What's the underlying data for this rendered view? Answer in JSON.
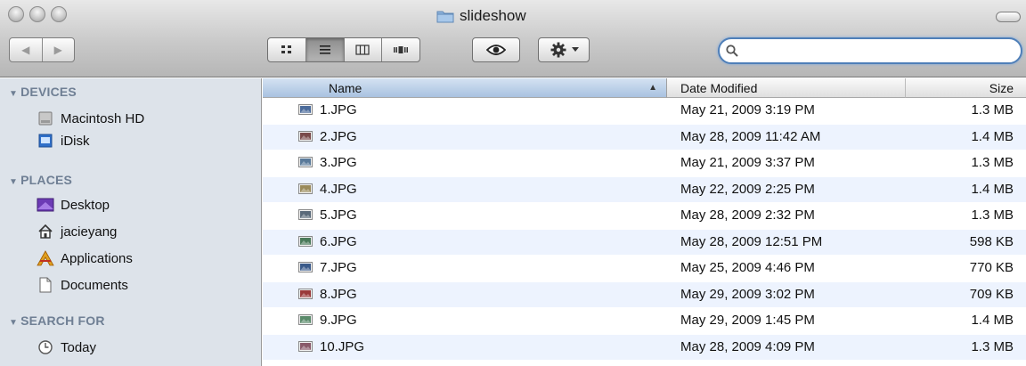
{
  "window": {
    "title": "slideshow"
  },
  "toolbar": {
    "back_glyph": "◀",
    "forward_glyph": "▶",
    "search": {
      "value": "",
      "placeholder": ""
    }
  },
  "sidebar": {
    "devices": {
      "label": "DEVICES",
      "items": [
        {
          "label": "Macintosh HD",
          "icon": "hard-drive-icon"
        },
        {
          "label": "iDisk",
          "icon": "idisk-icon"
        }
      ]
    },
    "places": {
      "label": "PLACES",
      "items": [
        {
          "label": "Desktop",
          "icon": "desktop-icon"
        },
        {
          "label": "jacieyang",
          "icon": "home-icon"
        },
        {
          "label": "Applications",
          "icon": "applications-icon"
        },
        {
          "label": "Documents",
          "icon": "documents-icon"
        }
      ]
    },
    "search_for": {
      "label": "SEARCH FOR",
      "items": [
        {
          "label": "Today",
          "icon": "clock-icon"
        }
      ]
    }
  },
  "columns": {
    "name": "Name",
    "date": "Date Modified",
    "size": "Size"
  },
  "files": [
    {
      "name": "1.JPG",
      "date": "May 21, 2009 3:19 PM",
      "size": "1.3 MB",
      "thumb": "#4a6a9a"
    },
    {
      "name": "2.JPG",
      "date": "May 28, 2009 11:42 AM",
      "size": "1.4 MB",
      "thumb": "#7a4a4a"
    },
    {
      "name": "3.JPG",
      "date": "May 21, 2009 3:37 PM",
      "size": "1.3 MB",
      "thumb": "#5a7a9a"
    },
    {
      "name": "4.JPG",
      "date": "May 22, 2009 2:25 PM",
      "size": "1.4 MB",
      "thumb": "#9a8a5a"
    },
    {
      "name": "5.JPG",
      "date": "May 28, 2009 2:32 PM",
      "size": "1.3 MB",
      "thumb": "#5a6a7a"
    },
    {
      "name": "6.JPG",
      "date": "May 28, 2009 12:51 PM",
      "size": "598 KB",
      "thumb": "#4a7a5a"
    },
    {
      "name": "7.JPG",
      "date": "May 25, 2009 4:46 PM",
      "size": "770 KB",
      "thumb": "#3a5a8a"
    },
    {
      "name": "8.JPG",
      "date": "May 29, 2009 3:02 PM",
      "size": "709 KB",
      "thumb": "#9a3a3a"
    },
    {
      "name": "9.JPG",
      "date": "May 29, 2009 1:45 PM",
      "size": "1.4 MB",
      "thumb": "#5a8a6a"
    },
    {
      "name": "10.JPG",
      "date": "May 28, 2009 4:09 PM",
      "size": "1.3 MB",
      "thumb": "#8a5a6a"
    }
  ],
  "colors": {
    "selected_header": "#a9c2e0",
    "alt_row": "#edf3fe",
    "sidebar_bg": "#dde3ea",
    "search_focus": "#4f7fb8"
  }
}
